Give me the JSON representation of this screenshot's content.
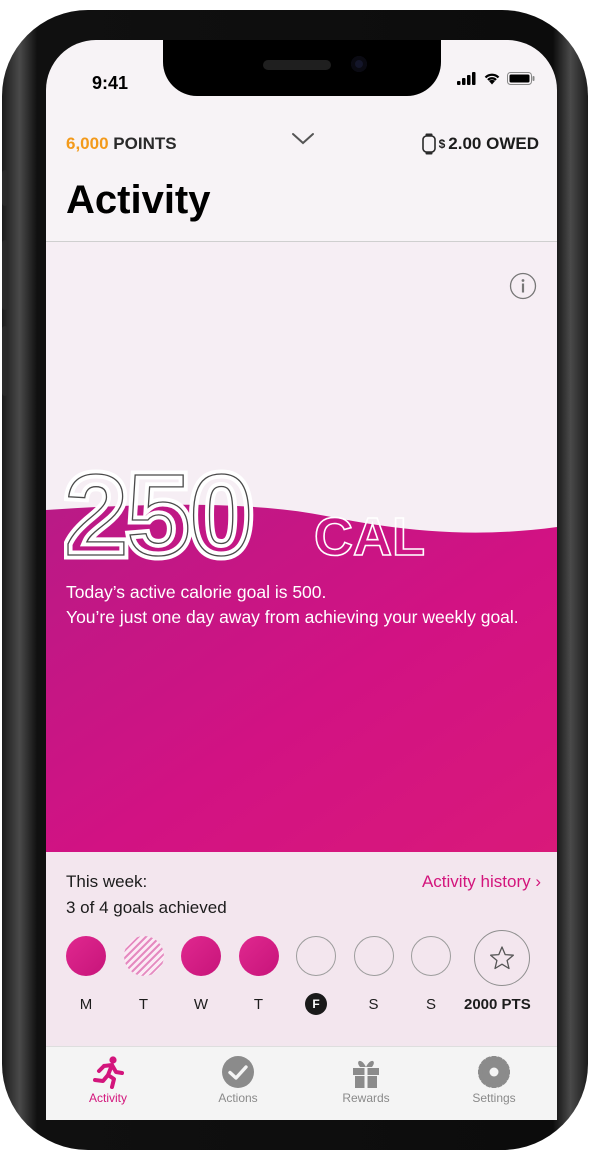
{
  "status": {
    "time": "9:41"
  },
  "header": {
    "points_value": "6,000",
    "points_label": "POINTS",
    "owed_currency": "$",
    "owed_amount": "2.00 OWED",
    "title": "Activity"
  },
  "goal": {
    "calories": "250",
    "unit": "CAL",
    "line1": "Today’s active calorie goal is 500.",
    "line2": "You’re just one day away from achieving your weekly goal."
  },
  "week": {
    "label": "This week:",
    "summary": "3 of 4 goals achieved",
    "history_link": "Activity history ›",
    "days": [
      {
        "letter": "M",
        "state": "done"
      },
      {
        "letter": "T",
        "state": "partial"
      },
      {
        "letter": "W",
        "state": "done"
      },
      {
        "letter": "T",
        "state": "done"
      },
      {
        "letter": "F",
        "state": "today"
      },
      {
        "letter": "S",
        "state": "empty"
      },
      {
        "letter": "S",
        "state": "empty"
      }
    ],
    "reward": "2000 PTS"
  },
  "tabs": [
    {
      "label": "Activity",
      "icon": "runner-icon",
      "active": true
    },
    {
      "label": "Actions",
      "icon": "checkmark-icon",
      "active": false
    },
    {
      "label": "Rewards",
      "icon": "gift-icon",
      "active": false
    },
    {
      "label": "Settings",
      "icon": "gear-icon",
      "active": false
    }
  ],
  "colors": {
    "accent": "#d3157c",
    "points": "#f39a1b",
    "done": "#d81b85"
  }
}
